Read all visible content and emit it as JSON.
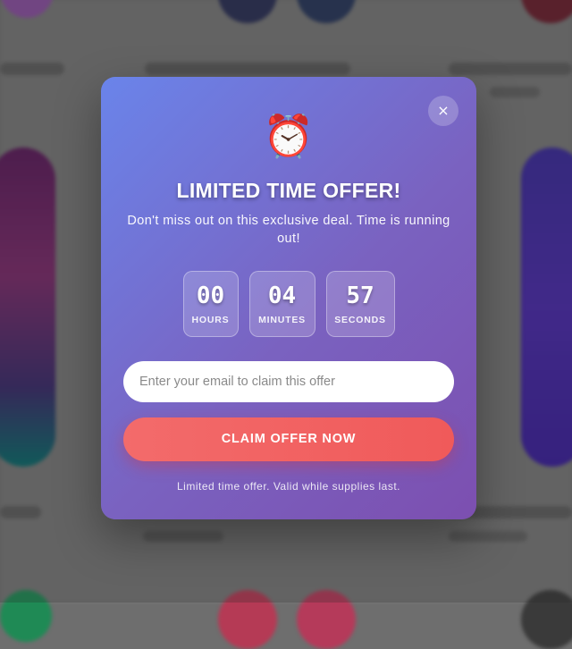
{
  "modal": {
    "close_icon": "×",
    "alarm_icon": "⏰",
    "title": "LIMITED TIME OFFER!",
    "subtitle": "Don't miss out on this exclusive deal. Time is running out!",
    "countdown": [
      {
        "value": "00",
        "label": "HOURS"
      },
      {
        "value": "04",
        "label": "MINUTES"
      },
      {
        "value": "57",
        "label": "SECONDS"
      }
    ],
    "email_placeholder": "Enter your email to claim this offer",
    "email_value": "",
    "claim_label": "CLAIM OFFER NOW",
    "footnote": "Limited time offer. Valid while supplies last."
  },
  "colors": {
    "modal_gradient_start": "#6a84ea",
    "modal_gradient_end": "#7c4fb0",
    "claim_button": "#f05a5a"
  }
}
